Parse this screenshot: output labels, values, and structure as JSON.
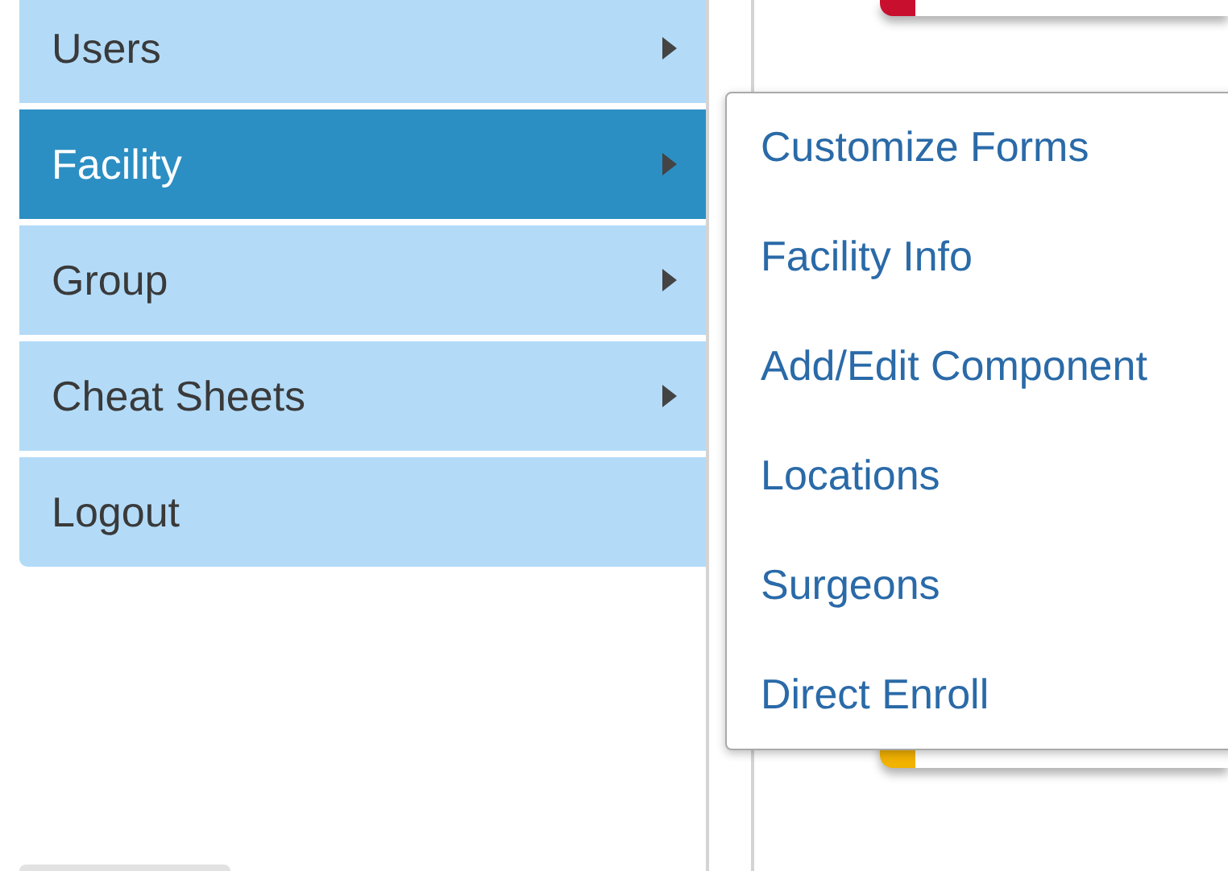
{
  "menu": {
    "items": [
      {
        "label": "Users",
        "selected": false,
        "has_submenu": true
      },
      {
        "label": "Facility",
        "selected": true,
        "has_submenu": true
      },
      {
        "label": "Group",
        "selected": false,
        "has_submenu": true
      },
      {
        "label": "Cheat Sheets",
        "selected": false,
        "has_submenu": true
      },
      {
        "label": "Logout",
        "selected": false,
        "has_submenu": false
      }
    ]
  },
  "submenu": {
    "items": [
      {
        "label": "Customize Forms"
      },
      {
        "label": "Facility Info"
      },
      {
        "label": "Add/Edit Component"
      },
      {
        "label": "Locations"
      },
      {
        "label": "Surgeons"
      },
      {
        "label": "Direct Enroll"
      }
    ]
  },
  "cards": [
    {
      "color": "#c8102e"
    },
    {
      "color": "#f2b200"
    }
  ]
}
